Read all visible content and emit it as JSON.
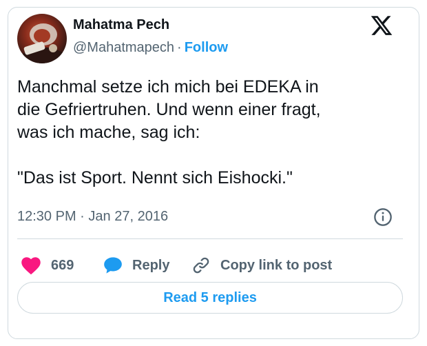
{
  "author": {
    "display_name": "Mahatma Pech",
    "handle": "@Mahatmapech",
    "separator": "·",
    "follow_label": "Follow"
  },
  "tweet": {
    "lines": [
      "Manchmal setze ich mich bei EDEKA in",
      "die Gefriertruhen. Und wenn einer fragt,",
      "was ich mache, sag ich:"
    ],
    "quote": "\"Das ist Sport. Nennt sich Eishocki.\"",
    "time": "12:30 PM",
    "date": "Jan 27, 2016",
    "meta_separator": "·"
  },
  "actions": {
    "like_count": "669",
    "reply_label": "Reply",
    "copy_label": "Copy link to post",
    "read_replies_label": "Read 5 replies"
  },
  "icons": {
    "logo": "x-logo-icon",
    "info": "info-icon",
    "like": "heart-icon",
    "reply": "speech-bubble-icon",
    "copy": "link-icon"
  },
  "colors": {
    "text": "#0f1419",
    "secondary": "#536471",
    "accent": "#1d9bf0",
    "like": "#f91880",
    "border": "#cfd9de"
  }
}
